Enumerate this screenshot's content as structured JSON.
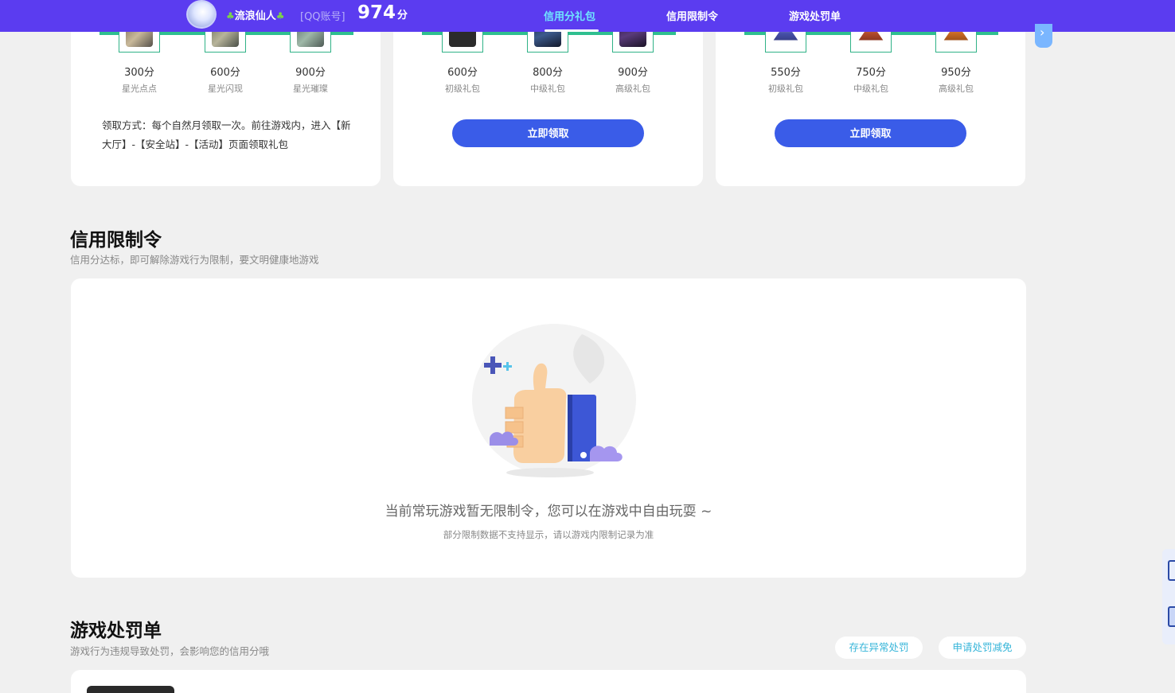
{
  "topbar": {
    "username": "流浪仙人",
    "account_type": "[QQ账号]",
    "score": "974",
    "score_unit": "分",
    "tabs": [
      {
        "label": "信用分礼包",
        "active": true
      },
      {
        "label": "信用限制令",
        "active": false
      },
      {
        "label": "游戏处罚单",
        "active": false
      }
    ]
  },
  "reward_cards": [
    {
      "items": [
        {
          "score": "300分",
          "name": "星光点点"
        },
        {
          "score": "600分",
          "name": "星光闪现"
        },
        {
          "score": "900分",
          "name": "星光璀璨"
        }
      ],
      "claim_text": "领取方式：每个自然月领取一次。前往游戏内，进入【新大厅】-【安全站】-【活动】页面领取礼包"
    },
    {
      "items": [
        {
          "score": "600分",
          "name": "初级礼包"
        },
        {
          "score": "800分",
          "name": "中级礼包"
        },
        {
          "score": "900分",
          "name": "高级礼包"
        }
      ],
      "button": "立即领取"
    },
    {
      "items": [
        {
          "score": "550分",
          "name": "初级礼包"
        },
        {
          "score": "750分",
          "name": "中级礼包"
        },
        {
          "score": "950分",
          "name": "高级礼包"
        }
      ],
      "button": "立即领取"
    }
  ],
  "restriction": {
    "title": "信用限制令",
    "subtitle": "信用分达标，即可解除游戏行为限制，要文明健康地游戏",
    "empty_main": "当前常玩游戏暂无限制令，您可以在游戏中自由玩耍 ~",
    "empty_sub": "部分限制数据不支持显示，请以游戏内限制记录为准"
  },
  "penalty": {
    "title": "游戏处罚单",
    "subtitle": "游戏行为违规导致处罚，会影响您的信用分哦",
    "btn_abnormal": "存在异常处罚",
    "btn_reduce": "申请处罚减免"
  },
  "colors": {
    "topbar": "#5b3cf0",
    "accent_tab": "#6fe5ff",
    "button": "#3a5ce8",
    "strip": "#2fbf8f",
    "link": "#36b5d9"
  }
}
